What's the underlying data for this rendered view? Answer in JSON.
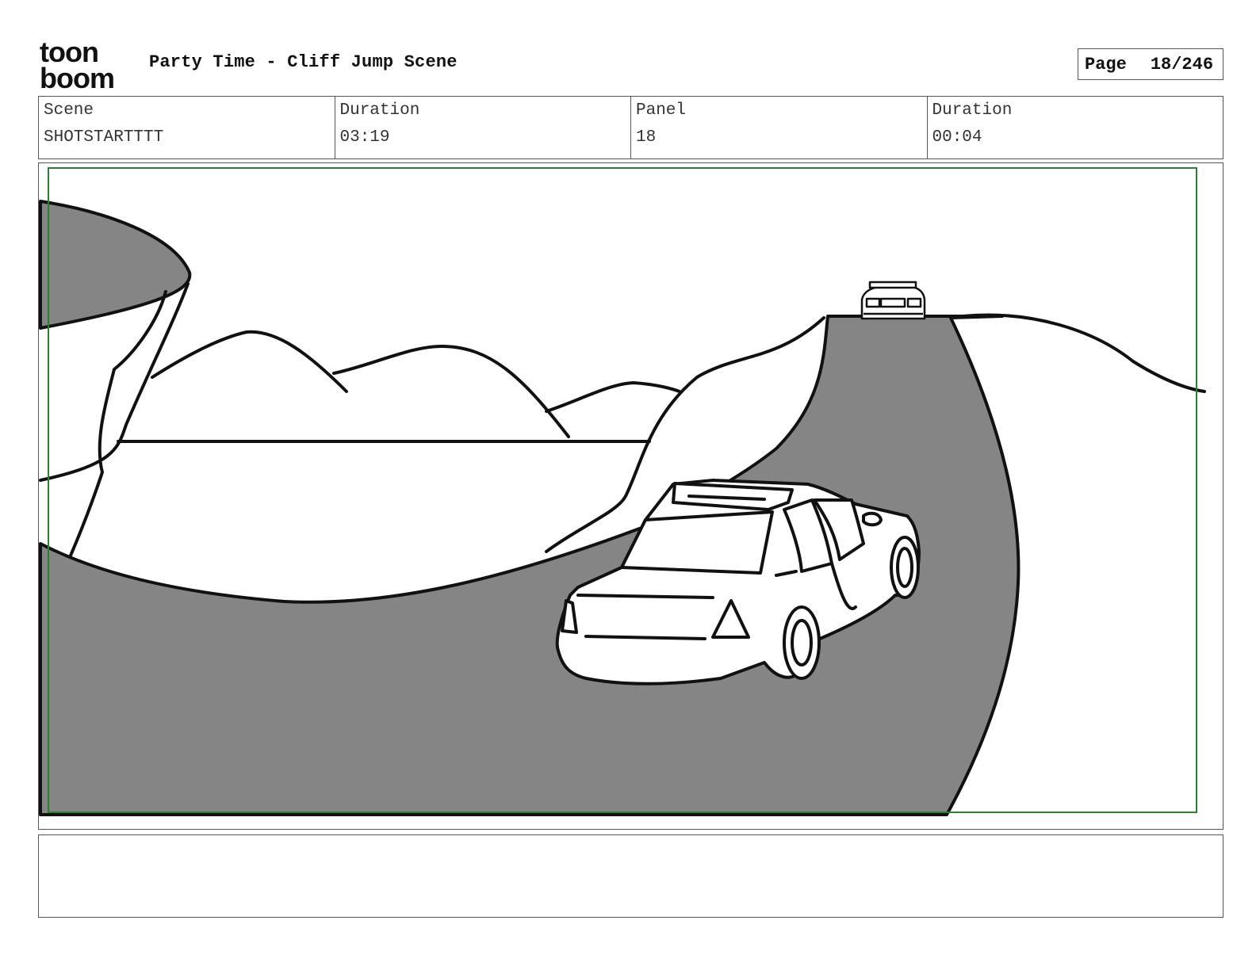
{
  "header": {
    "logo_top": "toon",
    "logo_bottom": "boom",
    "title": "Party Time - Cliff Jump Scene",
    "page_label": "Page",
    "page_number": "18/246"
  },
  "info": {
    "scene_label": "Scene",
    "scene_value": "SHOTSTARTTTT",
    "scene_duration_label": "Duration",
    "scene_duration_value": "03:19",
    "panel_label": "Panel",
    "panel_value": "18",
    "panel_duration_label": "Duration",
    "panel_duration_value": "00:04"
  },
  "colors": {
    "road_gray": "#858585",
    "safe_frame_green": "#2e7d32",
    "ink": "#111111"
  },
  "notes": {
    "text": ""
  }
}
